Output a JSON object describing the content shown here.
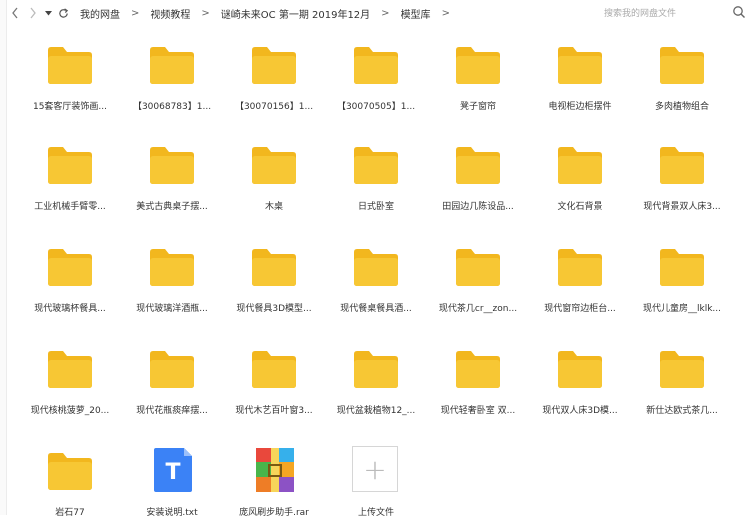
{
  "toolbar": {
    "back_icon": "chevron-left-icon",
    "forward_icon": "chevron-right-icon",
    "refresh_icon": "refresh-icon",
    "breadcrumbs": [
      "我的网盘",
      "视频教程",
      "谜崎未来OC 第一期 2019年12月",
      "模型库"
    ],
    "search_placeholder": "搜索我的网盘文件"
  },
  "colors": {
    "folder": "#F7C734",
    "folder_tab": "#F2B71E",
    "txt_blue": "#3B82F6"
  },
  "items": [
    {
      "label": "15套客厅装饰画...",
      "type": "folder"
    },
    {
      "label": "【30068783】1...",
      "type": "folder"
    },
    {
      "label": "【30070156】1...",
      "type": "folder"
    },
    {
      "label": "【30070505】1...",
      "type": "folder"
    },
    {
      "label": "凳子窗帘",
      "type": "folder"
    },
    {
      "label": "电视柜边柜摆件",
      "type": "folder"
    },
    {
      "label": "多肉植物组合",
      "type": "folder"
    },
    {
      "label": "工业机械手臂零...",
      "type": "folder"
    },
    {
      "label": "美式古典桌子摆...",
      "type": "folder"
    },
    {
      "label": "木桌",
      "type": "folder"
    },
    {
      "label": "日式卧室",
      "type": "folder"
    },
    {
      "label": "田园边几陈设品...",
      "type": "folder"
    },
    {
      "label": "文化石背景",
      "type": "folder"
    },
    {
      "label": "现代背景双人床3...",
      "type": "folder"
    },
    {
      "label": "现代玻璃杯餐具...",
      "type": "folder"
    },
    {
      "label": "现代玻璃洋酒瓶...",
      "type": "folder"
    },
    {
      "label": "现代餐具3D模型...",
      "type": "folder"
    },
    {
      "label": "现代餐桌餐具酒...",
      "type": "folder"
    },
    {
      "label": "现代茶几cr__zon...",
      "type": "folder"
    },
    {
      "label": "现代窗帘边柜台...",
      "type": "folder"
    },
    {
      "label": "现代儿童房__lklk...",
      "type": "folder"
    },
    {
      "label": "现代核桃菠萝_20...",
      "type": "folder"
    },
    {
      "label": "现代花瓶痰痒摆...",
      "type": "folder"
    },
    {
      "label": "现代木艺百叶窗3...",
      "type": "folder"
    },
    {
      "label": "现代盆栽植物12_...",
      "type": "folder"
    },
    {
      "label": "现代轻奢卧室 双...",
      "type": "folder"
    },
    {
      "label": "现代双人床3D模...",
      "type": "folder"
    },
    {
      "label": "新仕达欧式茶几...",
      "type": "folder"
    },
    {
      "label": "岩石77",
      "type": "folder"
    },
    {
      "label": "安装说明.txt",
      "type": "txt",
      "glyph": "T"
    },
    {
      "label": "庞风刷步助手.rar",
      "type": "rar"
    },
    {
      "label": "上传文件",
      "type": "upload",
      "glyph": "+"
    }
  ]
}
